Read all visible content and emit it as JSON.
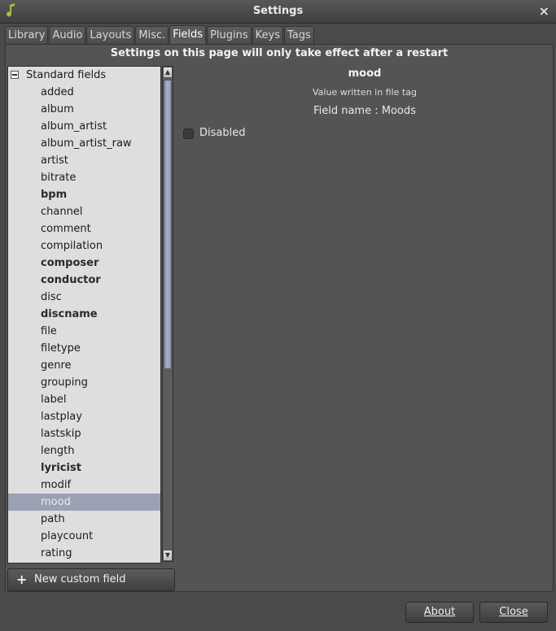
{
  "window": {
    "title": "Settings",
    "close_glyph": "×",
    "icon": "music-note-icon"
  },
  "tabs": [
    {
      "label": "Library"
    },
    {
      "label": "Audio"
    },
    {
      "label": "Layouts"
    },
    {
      "label": "Misc."
    },
    {
      "label": "Fields",
      "active": true
    },
    {
      "label": "Plugins"
    },
    {
      "label": "Keys"
    },
    {
      "label": "Tags"
    }
  ],
  "notice": "Settings on this page will only take effect after a restart",
  "tree": {
    "root_label": "Standard fields",
    "items": [
      {
        "label": "added"
      },
      {
        "label": "album"
      },
      {
        "label": "album_artist"
      },
      {
        "label": "album_artist_raw"
      },
      {
        "label": "artist"
      },
      {
        "label": "bitrate"
      },
      {
        "label": "bpm",
        "bold": true
      },
      {
        "label": "channel"
      },
      {
        "label": "comment"
      },
      {
        "label": "compilation"
      },
      {
        "label": "composer",
        "bold": true
      },
      {
        "label": "conductor",
        "bold": true
      },
      {
        "label": "disc"
      },
      {
        "label": "discname",
        "bold": true
      },
      {
        "label": "file"
      },
      {
        "label": "filetype"
      },
      {
        "label": "genre"
      },
      {
        "label": "grouping"
      },
      {
        "label": "label"
      },
      {
        "label": "lastplay"
      },
      {
        "label": "lastskip"
      },
      {
        "label": "length"
      },
      {
        "label": "lyricist",
        "bold": true
      },
      {
        "label": "modif"
      },
      {
        "label": "mood",
        "selected": true
      },
      {
        "label": "path"
      },
      {
        "label": "playcount"
      },
      {
        "label": "rating"
      }
    ]
  },
  "new_field_button": {
    "label": "New custom field",
    "icon": "plus-icon"
  },
  "detail": {
    "title": "mood",
    "subtitle": "Value written in file tag",
    "field_name": "Field name : Moods",
    "disabled_label": "Disabled",
    "disabled_checked": false
  },
  "footer": {
    "about_label": "About",
    "close_label": "Close"
  },
  "colors": {
    "background": "#4a4a4a",
    "selection": "#9aa1b4",
    "tree_bg": "#dedede"
  }
}
